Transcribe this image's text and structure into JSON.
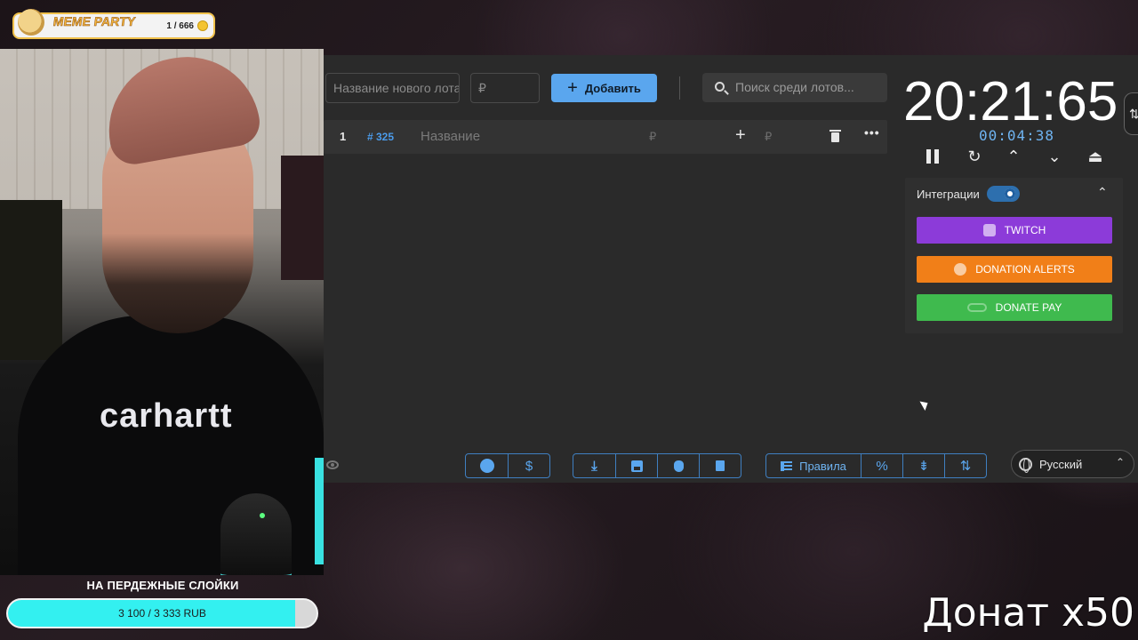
{
  "overlay": {
    "brand": "MEME PARTY",
    "counter": "1 / 666",
    "goal_title": "НА ПЕРДЕЖНЫЕ СЛОЙКИ",
    "goal_text": "3 100 / 3 333 RUB",
    "goal_progress": 0.93,
    "donation_multiplier": "Донат x50",
    "shirt_text": "carhartt"
  },
  "auction": {
    "new_lot_placeholder": "Название нового лота",
    "amount_placeholder": "₽",
    "add_button": "Добавить",
    "search_placeholder": "Поиск среди лотов...",
    "lots": [
      {
        "index": "1",
        "id": "# 325",
        "name_placeholder": "Название",
        "amount_placeholder": "₽",
        "add_icon": "+",
        "extra_placeholder": "₽",
        "more": "•••"
      }
    ],
    "toolbar": {
      "rules_label": "Правила",
      "percent_label": "%",
      "language": "Русский"
    }
  },
  "timer": {
    "main": "20:21:65",
    "elapsed": "00:04:38",
    "controls": [
      "pause-icon",
      "restart-icon",
      "chevron-up-icon",
      "chevron-down-icon",
      "eject-icon"
    ]
  },
  "integrations": {
    "label": "Интеграции",
    "enabled": true,
    "buttons": [
      {
        "label": "TWITCH",
        "color": "#8c3bd9"
      },
      {
        "label": "DONATION ALERTS",
        "color": "#f17f18"
      },
      {
        "label": "DONATE PAY",
        "color": "#3fba4e"
      }
    ]
  },
  "colors": {
    "accent": "#5aa6ee",
    "goal_fill": "#33f0f0",
    "panel": "#2a2a2a"
  }
}
